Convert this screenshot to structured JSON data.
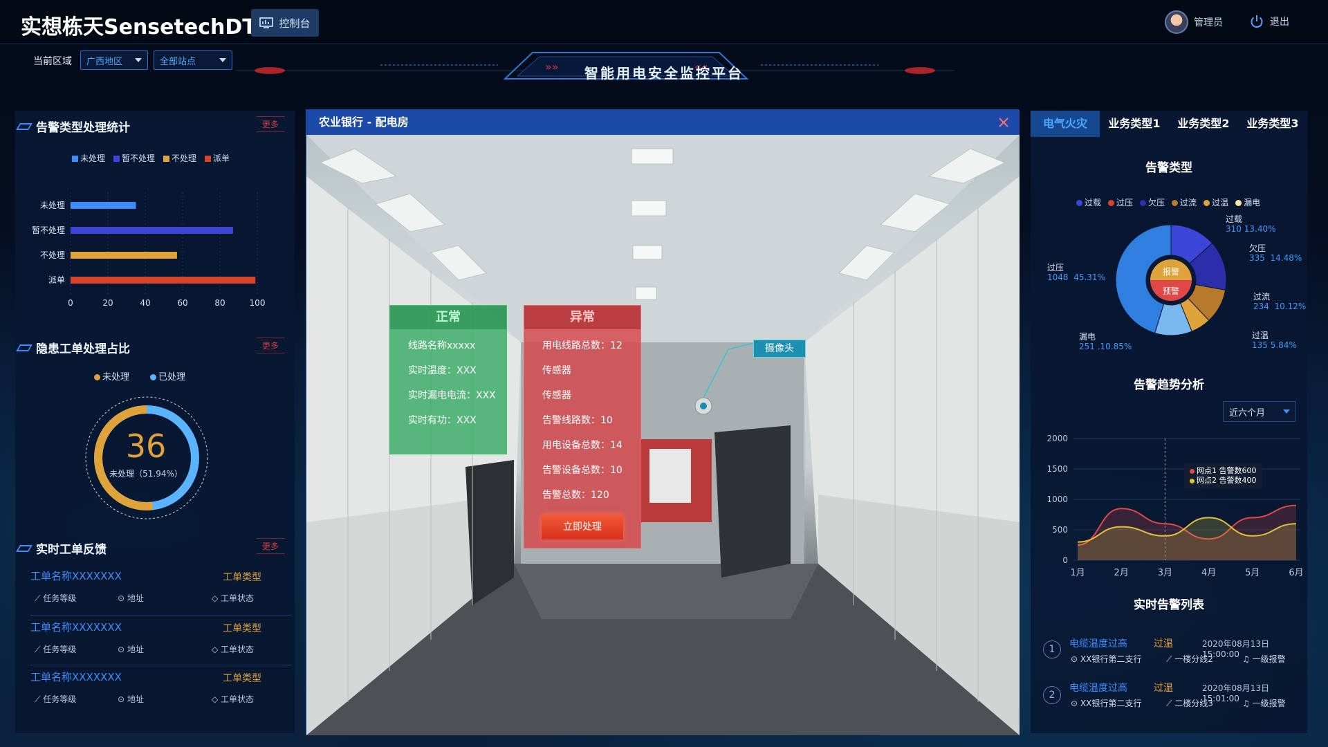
{
  "header": {
    "logo": "实想栋天SensetechDT",
    "console_label": "控制台",
    "user_label": "管理员",
    "logout_label": "退出"
  },
  "region_bar": {
    "label": "当前区域",
    "region_select": "广西地区",
    "station_select": "全部站点",
    "platform_title": "智能用电安全监控平台"
  },
  "alarm_stats": {
    "title": "告警类型处理统计",
    "more": "更多",
    "legend": [
      {
        "name": "未处理",
        "color": "#3d8cff"
      },
      {
        "name": "暂不处理",
        "color": "#3b45d8"
      },
      {
        "name": "不处理",
        "color": "#e0a23a"
      },
      {
        "name": "派单",
        "color": "#d5432b"
      }
    ],
    "categories": [
      "未处理",
      "暂不处理",
      "不处理",
      "派单"
    ],
    "values": [
      35,
      87,
      57,
      99
    ],
    "x_ticks": [
      "0",
      "20",
      "40",
      "60",
      "80",
      "100"
    ]
  },
  "hazard": {
    "title": "隐患工单处理占比",
    "more": "更多",
    "legend": [
      {
        "name": "未处理",
        "color": "#e0a23a"
      },
      {
        "name": "已处理",
        "color": "#5ab4ff"
      }
    ],
    "count": "36",
    "sub_label": "未处理（51.94%）",
    "percent": 51.94
  },
  "feedback": {
    "title": "实时工单反馈",
    "more": "更多",
    "items": [
      {
        "name": "工单名称XXXXXXX",
        "type": "工单类型",
        "level": "任务等级",
        "address": "地址",
        "status": "工单状态"
      },
      {
        "name": "工单名称XXXXXXX",
        "type": "工单类型",
        "level": "任务等级",
        "address": "地址",
        "status": "工单状态"
      },
      {
        "name": "工单名称XXXXXXX",
        "type": "工单类型",
        "level": "任务等级",
        "address": "地址",
        "status": "工单状态"
      }
    ]
  },
  "modal": {
    "title": "农业银行 - 配电房",
    "normal": {
      "title": "正常",
      "rows": [
        "线路名称xxxxx",
        "实时温度：XXX",
        "实时漏电电流：XXX",
        "实时有功：XXX"
      ]
    },
    "abnormal": {
      "title": "异常",
      "rows": [
        "用电线路总数：12",
        "传感器",
        "传感器",
        "告警线路数：10",
        "用电设备总数：14",
        "告警设备总数：10",
        "告警总数：120"
      ],
      "button": "立即处理"
    },
    "camera_label": "摄像头"
  },
  "right_tabs": [
    "电气火灾",
    "业务类型1",
    "业务类型2",
    "业务类型3"
  ],
  "alarm_type": {
    "title": "告警类型",
    "legend": [
      {
        "name": "过载",
        "color": "#3b45d8"
      },
      {
        "name": "过压",
        "color": "#d5432b"
      },
      {
        "name": "欠压",
        "color": "#2d2fb0"
      },
      {
        "name": "过流",
        "color": "#b77a2a"
      },
      {
        "name": "过温",
        "color": "#e0a23a"
      },
      {
        "name": "漏电",
        "color": "#ffe6a0"
      }
    ],
    "center_top": "报警",
    "center_bottom": "预警",
    "slices": [
      {
        "name": "过载",
        "value": "310",
        "pct": "13.40%",
        "share": 13.4,
        "color": "#3b45d8"
      },
      {
        "name": "欠压",
        "value": "335",
        "pct": "14.48%",
        "share": 14.48,
        "color": "#2b2ea8"
      },
      {
        "name": "过流",
        "value": "234",
        "pct": "10.12%",
        "share": 10.12,
        "color": "#b77a2a"
      },
      {
        "name": "过温",
        "value": "135",
        "pct": "5.84%",
        "share": 5.84,
        "color": "#e0a23a"
      },
      {
        "name": "漏电",
        "value": "251",
        "pct": "10.85%",
        "share": 10.85,
        "color": "#7cb8f0"
      },
      {
        "name": "过压",
        "value": "1048",
        "pct": "45.31%",
        "share": 45.31,
        "color": "#2f7fe0"
      }
    ]
  },
  "trend": {
    "title": "告警趋势分析",
    "range_select": "近六个月",
    "y_ticks": [
      "2000",
      "1500",
      "1000",
      "500",
      "0"
    ],
    "x_ticks": [
      "1月",
      "2月",
      "3月",
      "4月",
      "5月",
      "6月"
    ],
    "tooltip": [
      "网点1  告警数600",
      "网点2  告警数400"
    ],
    "tooltip_colors": [
      "#e04848",
      "#e0c23a"
    ]
  },
  "chart_data": {
    "type": "area",
    "categories": [
      "1月",
      "2月",
      "3月",
      "4月",
      "5月",
      "6月"
    ],
    "series": [
      {
        "name": "网点1",
        "values": [
          250,
          850,
          600,
          350,
          700,
          900
        ]
      },
      {
        "name": "网点2",
        "values": [
          300,
          550,
          400,
          700,
          400,
          600
        ]
      }
    ],
    "ylim": [
      0,
      2000
    ]
  },
  "realtime_alarms": {
    "title": "实时告警列表",
    "items": [
      {
        "index": "1",
        "name": "电缆温度过高",
        "type": "过温",
        "time": "2020年08月13日15:00:00",
        "bank": "XX银行第二支行",
        "line": "一楼分线2",
        "level": "一级报警"
      },
      {
        "index": "2",
        "name": "电缆温度过高",
        "type": "过温",
        "time": "2020年08月13日15:01:00",
        "bank": "XX银行第二支行",
        "line": "二楼分线3",
        "level": "一级报警"
      }
    ]
  }
}
